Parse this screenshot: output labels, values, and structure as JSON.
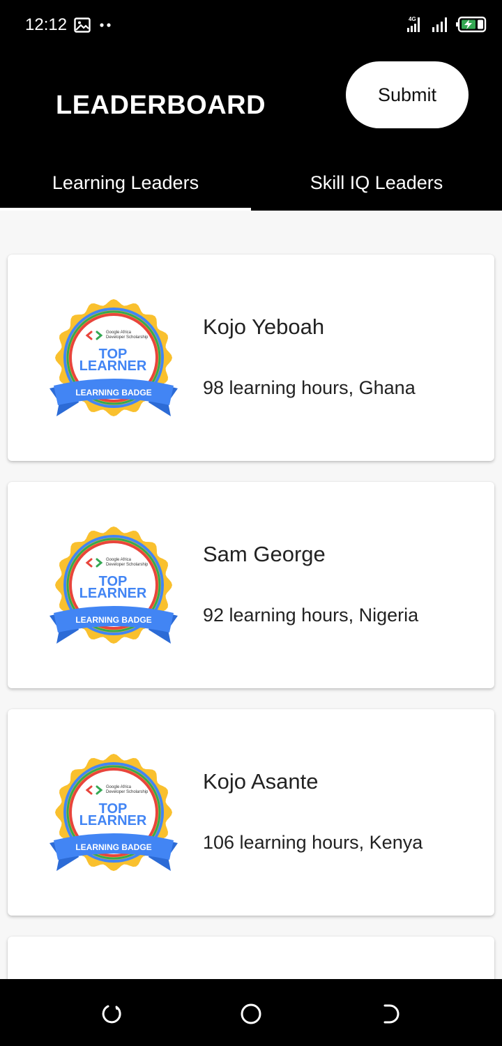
{
  "status_bar": {
    "time": "12:12",
    "network": "4G",
    "icons": [
      "image-icon",
      "more-dots-icon",
      "signal-4g-icon",
      "signal-icon",
      "battery-charging-icon"
    ]
  },
  "header": {
    "title": "LEADERBOARD",
    "submit_label": "Submit"
  },
  "tabs": [
    {
      "label": "Learning Leaders",
      "selected": true
    },
    {
      "label": "Skill IQ Leaders",
      "selected": false
    }
  ],
  "badge": {
    "brand_line1": "Google Africa",
    "brand_line2": "Developer Scholarship",
    "title_line1": "TOP",
    "title_line2": "LEARNER",
    "ribbon": "LEARNING BADGE"
  },
  "leaders": [
    {
      "name": "Kojo Yeboah",
      "detail": "98 learning hours, Ghana"
    },
    {
      "name": "Sam George",
      "detail": "92 learning hours, Nigeria"
    },
    {
      "name": "Kojo Asante",
      "detail": "106 learning hours, Kenya"
    }
  ],
  "nav_bar": {
    "icons": [
      "recents-icon",
      "home-icon",
      "back-icon"
    ]
  },
  "colors": {
    "background": "#f7f7f7",
    "app_bar": "#000000",
    "badge_gold": "#f9c02e",
    "badge_blue": "#4285f4",
    "badge_red": "#e8453c",
    "badge_green": "#34a853"
  }
}
